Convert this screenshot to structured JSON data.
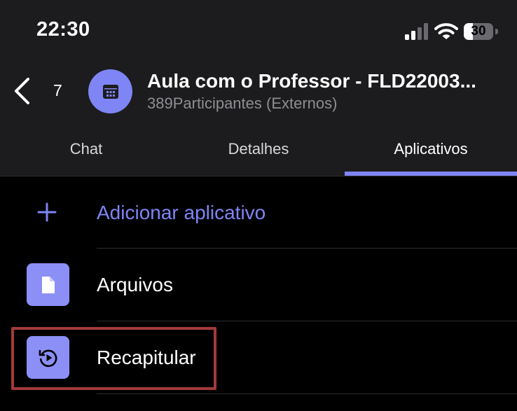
{
  "status_bar": {
    "time": "22:30",
    "battery_level": "30",
    "battery_fraction": 0.3
  },
  "header": {
    "back_count": "7",
    "title": "Aula com o Professor - FLD22003...",
    "subtitle": "389Participantes (Externos)",
    "avatar_icon": "calendar-icon"
  },
  "tabs": [
    {
      "label": "Chat",
      "active": false
    },
    {
      "label": "Detalhes",
      "active": false
    },
    {
      "label": "Aplicativos",
      "active": true
    }
  ],
  "apps": {
    "add_label": "Adicionar aplicativo",
    "items": [
      {
        "label": "Arquivos",
        "icon": "file-icon"
      },
      {
        "label": "Recapitular",
        "icon": "recap-icon",
        "highlighted": true
      }
    ]
  },
  "colors": {
    "accent": "#7f85f5",
    "header_bg": "#1c1c1e",
    "list_bg": "#000000",
    "highlight_border": "#a33a3a"
  }
}
